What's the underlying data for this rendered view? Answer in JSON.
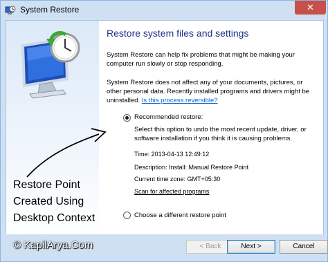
{
  "window": {
    "title": "System Restore",
    "close_glyph": "✕"
  },
  "main": {
    "heading": "Restore system files and settings",
    "para1": "System Restore can help fix problems that might be making your computer run slowly or stop responding.",
    "para2": "System Restore does not affect any of your documents, pictures, or other personal data. Recently installed programs and drivers might be uninstalled.",
    "reversible_link": "Is this process reversible?",
    "recommended": {
      "label": "Recommended restore:",
      "checked": true,
      "description": "Select this option to undo the most recent update, driver, or software installation if you think it is causing problems.",
      "time": "Time: 2013-04-13 12:49:12",
      "desc_line": "Description: Install: Manual Restore Point",
      "timezone": "Current time zone: GMT+05:30",
      "scan_link": "Scan for affected programs"
    },
    "different": {
      "label": "Choose a different restore point",
      "checked": false
    }
  },
  "annotation": {
    "line1": "Restore Point",
    "line2": "Created Using",
    "line3": "Desktop Context"
  },
  "buttons": {
    "back": "< Back",
    "next": "Next >",
    "cancel": "Cancel"
  },
  "watermark": "© KapilArya.Com",
  "icons": [
    "system-restore-icon",
    "monitor-icon",
    "clock-icon",
    "restore-arrow-icon",
    "close-icon"
  ]
}
